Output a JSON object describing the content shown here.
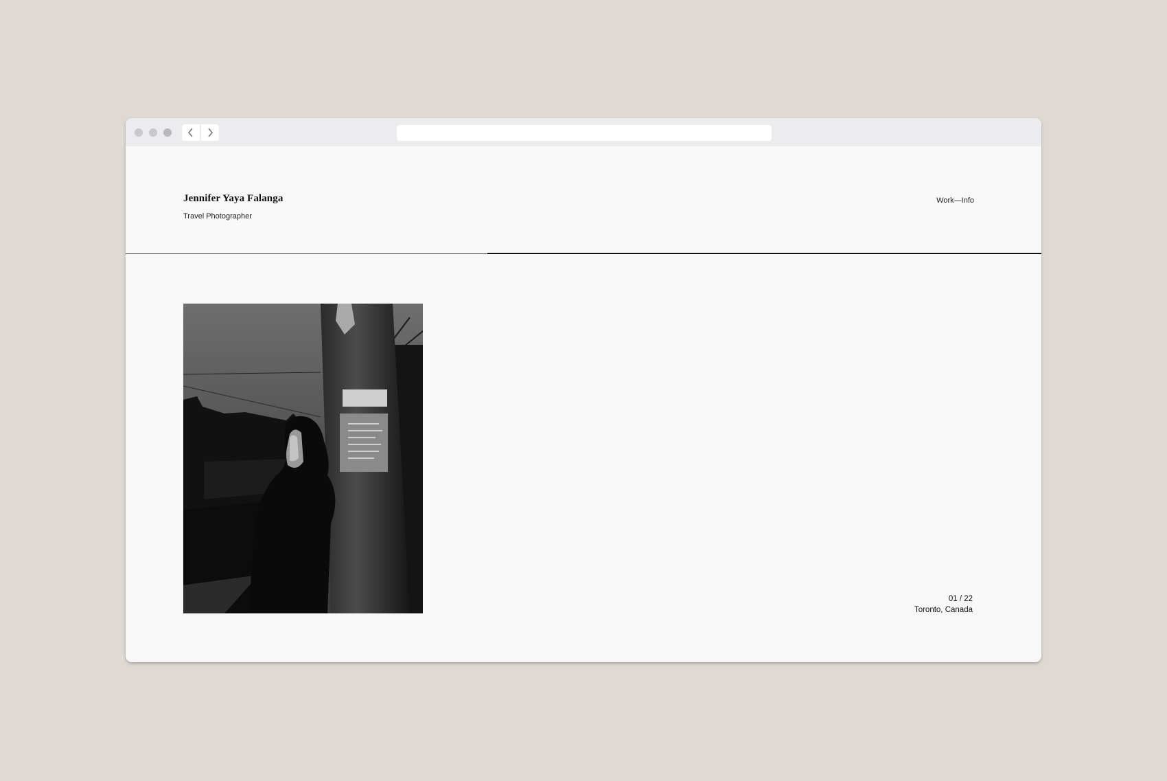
{
  "site": {
    "name": "Jennifer Yaya Falanga",
    "subtitle": "Travel Photographer"
  },
  "nav": {
    "work": "Work",
    "separator": "—",
    "info": "Info"
  },
  "gallery": {
    "counter": "01 / 22",
    "location": "Toronto, Canada"
  },
  "icons": {
    "back": "chevron-left-icon",
    "forward": "chevron-right-icon"
  },
  "colors": {
    "page_background": "#f8f8f9",
    "outer_background": "#dedad3",
    "chrome": "#ececee",
    "text": "#111111"
  }
}
